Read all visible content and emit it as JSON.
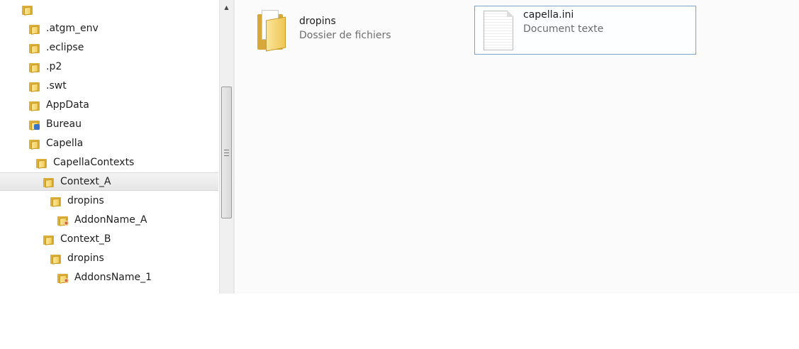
{
  "navigation": {
    "top_label": "",
    "items": [
      {
        "label": ".atgm_env",
        "indent": 0,
        "icon": "folder-icon"
      },
      {
        "label": ".eclipse",
        "indent": 0,
        "icon": "folder-icon"
      },
      {
        "label": ".p2",
        "indent": 0,
        "icon": "folder-icon"
      },
      {
        "label": ".swt",
        "indent": 0,
        "icon": "folder-icon"
      },
      {
        "label": "AppData",
        "indent": 0,
        "icon": "folder-icon"
      },
      {
        "label": "Bureau",
        "indent": 0,
        "icon": "desktop-folder-icon"
      },
      {
        "label": "Capella",
        "indent": 0,
        "icon": "folder-icon"
      },
      {
        "label": "CapellaContexts",
        "indent": 1,
        "icon": "folder-icon"
      },
      {
        "label": "Context_A",
        "indent": 2,
        "icon": "folder-icon",
        "selected": true
      },
      {
        "label": "dropins",
        "indent": 3,
        "icon": "folder-icon"
      },
      {
        "label": "AddonName_A",
        "indent": 4,
        "icon": "addon-folder-icon"
      },
      {
        "label": "Context_B",
        "indent": 2,
        "icon": "folder-icon"
      },
      {
        "label": "dropins",
        "indent": 3,
        "icon": "folder-icon"
      },
      {
        "label": "AddonsName_1",
        "indent": 4,
        "icon": "addon-folder-icon"
      }
    ]
  },
  "content": {
    "items": [
      {
        "name": "dropins",
        "type": "Dossier de fichiers",
        "icon": "folder-icon"
      },
      {
        "name": "capella.ini",
        "type": "Document texte",
        "icon": "text-document-icon",
        "selected": true
      }
    ]
  },
  "colors": {
    "selection_border": "#7da2ce",
    "folder_yellow": "#f3cd5a",
    "text_secondary": "#6d6d6d"
  }
}
